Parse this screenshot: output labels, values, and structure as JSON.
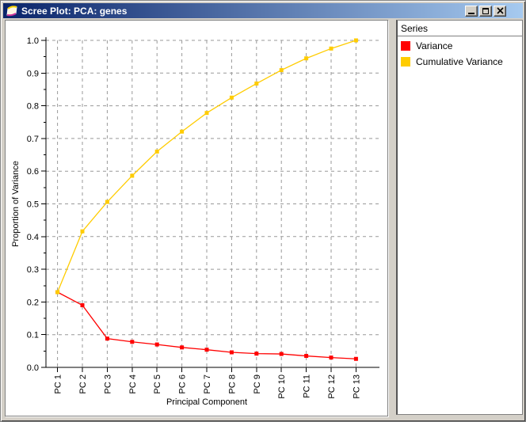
{
  "window": {
    "title": "Scree Plot: PCA: genes",
    "icon": "app-fan-icon",
    "buttons": [
      {
        "name": "minimize",
        "icon": "minimize-icon"
      },
      {
        "name": "maximize",
        "icon": "maximize-icon"
      },
      {
        "name": "close",
        "icon": "close-icon"
      }
    ],
    "titlebar_colors": {
      "left": "#0a246a",
      "right": "#a6caf0"
    }
  },
  "legend": {
    "header": "Series",
    "items": [
      {
        "label": "Variance",
        "color": "#ff0000"
      },
      {
        "label": "Cumulative Variance",
        "color": "#ffcc00"
      }
    ]
  },
  "chart_data": {
    "type": "line",
    "title": "",
    "xlabel": "Principal Component",
    "ylabel": "Proportion of Variance",
    "categories": [
      "PC 1",
      "PC 2",
      "PC 3",
      "PC 4",
      "PC 5",
      "PC 6",
      "PC 7",
      "PC 8",
      "PC 9",
      "PC 10",
      "PC 11",
      "PC 12",
      "PC 13"
    ],
    "series": [
      {
        "name": "Variance",
        "color": "#ff0000",
        "marker": "square",
        "values": [
          0.23,
          0.19,
          0.088,
          0.078,
          0.07,
          0.061,
          0.054,
          0.046,
          0.042,
          0.041,
          0.035,
          0.03,
          0.026
        ]
      },
      {
        "name": "Cumulative Variance",
        "color": "#ffcc00",
        "marker": "square",
        "values": [
          0.23,
          0.416,
          0.506,
          0.586,
          0.66,
          0.721,
          0.778,
          0.825,
          0.868,
          0.909,
          0.945,
          0.975,
          1.0
        ]
      }
    ],
    "ylim": [
      0.0,
      1.0
    ],
    "yticks": [
      "0.0",
      "0.1",
      "0.2",
      "0.3",
      "0.4",
      "0.5",
      "0.6",
      "0.7",
      "0.8",
      "0.9",
      "1.0"
    ],
    "y_minor_tick_step": 0.05,
    "grid": "dashed",
    "grid_color": "#999999",
    "legend_position": "right-panel"
  }
}
